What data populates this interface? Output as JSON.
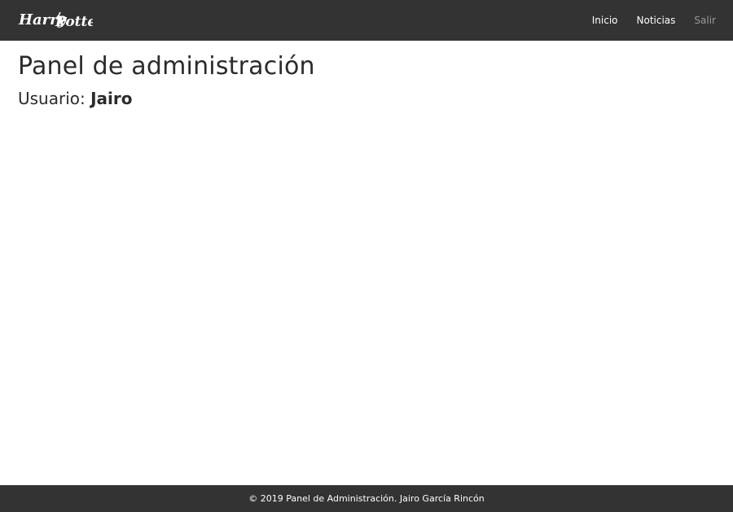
{
  "navbar": {
    "brand_text": "Harry Potter",
    "links": [
      {
        "label": "Inicio"
      },
      {
        "label": "Noticias"
      },
      {
        "label": "Salir"
      }
    ]
  },
  "main": {
    "title": "Panel de administración",
    "user_label": "Usuario:",
    "user_name": "Jairo"
  },
  "footer": {
    "text": "© 2019 Panel de Administración. Jairo García Rincón"
  },
  "colors": {
    "navbar_bg": "#333333",
    "link": "#ffffff",
    "link_muted": "#9a9a9a",
    "footer_bg": "#333333"
  }
}
